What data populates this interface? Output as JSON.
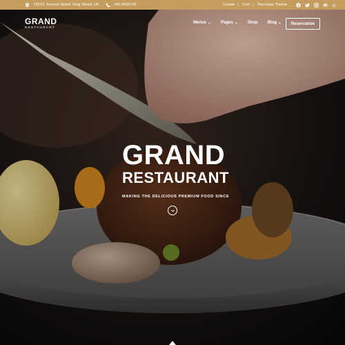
{
  "topbar": {
    "address": "732/21 Second Street, King Street, UK",
    "phone": "+65.4566743",
    "links": [
      "Locate",
      "Cart",
      "Purchase Theme"
    ],
    "social_icons": [
      "facebook-icon",
      "twitter-icon",
      "instagram-icon",
      "tripadvisor-icon",
      "yelp-icon"
    ]
  },
  "header": {
    "logo_title": "GRAND",
    "logo_subtitle": "RESTAURANT",
    "nav": [
      {
        "label": "Menus",
        "has_dropdown": true
      },
      {
        "label": "Pages",
        "has_dropdown": true
      },
      {
        "label": "Shop",
        "has_dropdown": false
      },
      {
        "label": "Blog",
        "has_dropdown": true
      }
    ],
    "cta": "Reservation"
  },
  "hero": {
    "title_line1": "GRAND",
    "title_line2": "RESTAURANT",
    "tagline": "MAKING THE DELICIOUS PREMIUM FOOD SINCE"
  },
  "colors": {
    "topbar": "#c59d5f",
    "text": "#ffffff"
  }
}
